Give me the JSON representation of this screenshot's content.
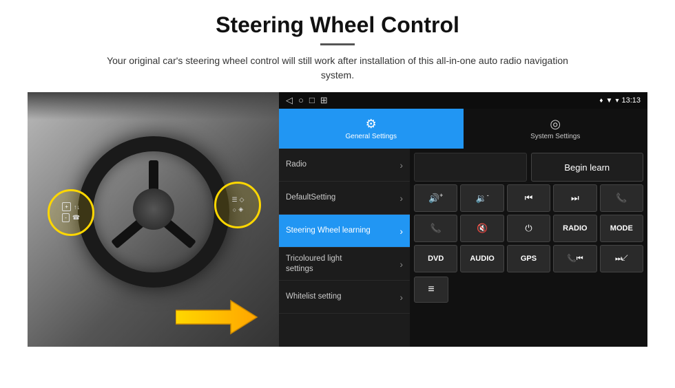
{
  "header": {
    "title": "Steering Wheel Control",
    "subtitle": "Your original car's steering wheel control will still work after installation of this all-in-one auto radio navigation system."
  },
  "status_bar": {
    "nav_back": "◁",
    "nav_home": "○",
    "nav_square": "□",
    "nav_menu": "⊞",
    "signal_icon": "▼",
    "wifi_icon": "▾",
    "time": "13:13",
    "location_icon": "♦"
  },
  "tabs": [
    {
      "id": "general",
      "label": "General Settings",
      "icon": "⚙",
      "active": true
    },
    {
      "id": "system",
      "label": "System Settings",
      "icon": "◎",
      "active": false
    }
  ],
  "menu_items": [
    {
      "id": "radio",
      "label": "Radio",
      "active": false
    },
    {
      "id": "default",
      "label": "DefaultSetting",
      "active": false
    },
    {
      "id": "steering",
      "label": "Steering Wheel learning",
      "active": true
    },
    {
      "id": "tricoloured",
      "label": "Tricoloured light\nsettings",
      "active": false,
      "multiline": true
    },
    {
      "id": "whitelist",
      "label": "Whitelist setting",
      "active": false
    }
  ],
  "panel": {
    "begin_learn_label": "Begin learn",
    "grid_row1": [
      {
        "id": "vol_up",
        "content": "🔊+",
        "type": "icon"
      },
      {
        "id": "vol_down",
        "content": "🔉-",
        "type": "icon"
      },
      {
        "id": "prev_track",
        "content": "⏮",
        "type": "icon"
      },
      {
        "id": "next_track",
        "content": "⏭",
        "type": "icon"
      },
      {
        "id": "phone",
        "content": "📞",
        "type": "icon"
      }
    ],
    "grid_row2": [
      {
        "id": "call_answer",
        "content": "📞",
        "type": "icon"
      },
      {
        "id": "mute",
        "content": "🔇",
        "type": "icon"
      },
      {
        "id": "power",
        "content": "⏻",
        "type": "icon"
      },
      {
        "id": "radio_btn",
        "content": "RADIO",
        "type": "text"
      },
      {
        "id": "mode_btn",
        "content": "MODE",
        "type": "text"
      }
    ],
    "grid_row3": [
      {
        "id": "dvd_btn",
        "content": "DVD",
        "type": "text"
      },
      {
        "id": "audio_btn",
        "content": "AUDIO",
        "type": "text"
      },
      {
        "id": "gps_btn",
        "content": "GPS",
        "type": "text"
      },
      {
        "id": "phone2",
        "content": "📞⏮",
        "type": "icon"
      },
      {
        "id": "skip",
        "content": "⏭↙",
        "type": "icon"
      }
    ],
    "last_icon": "≡"
  }
}
